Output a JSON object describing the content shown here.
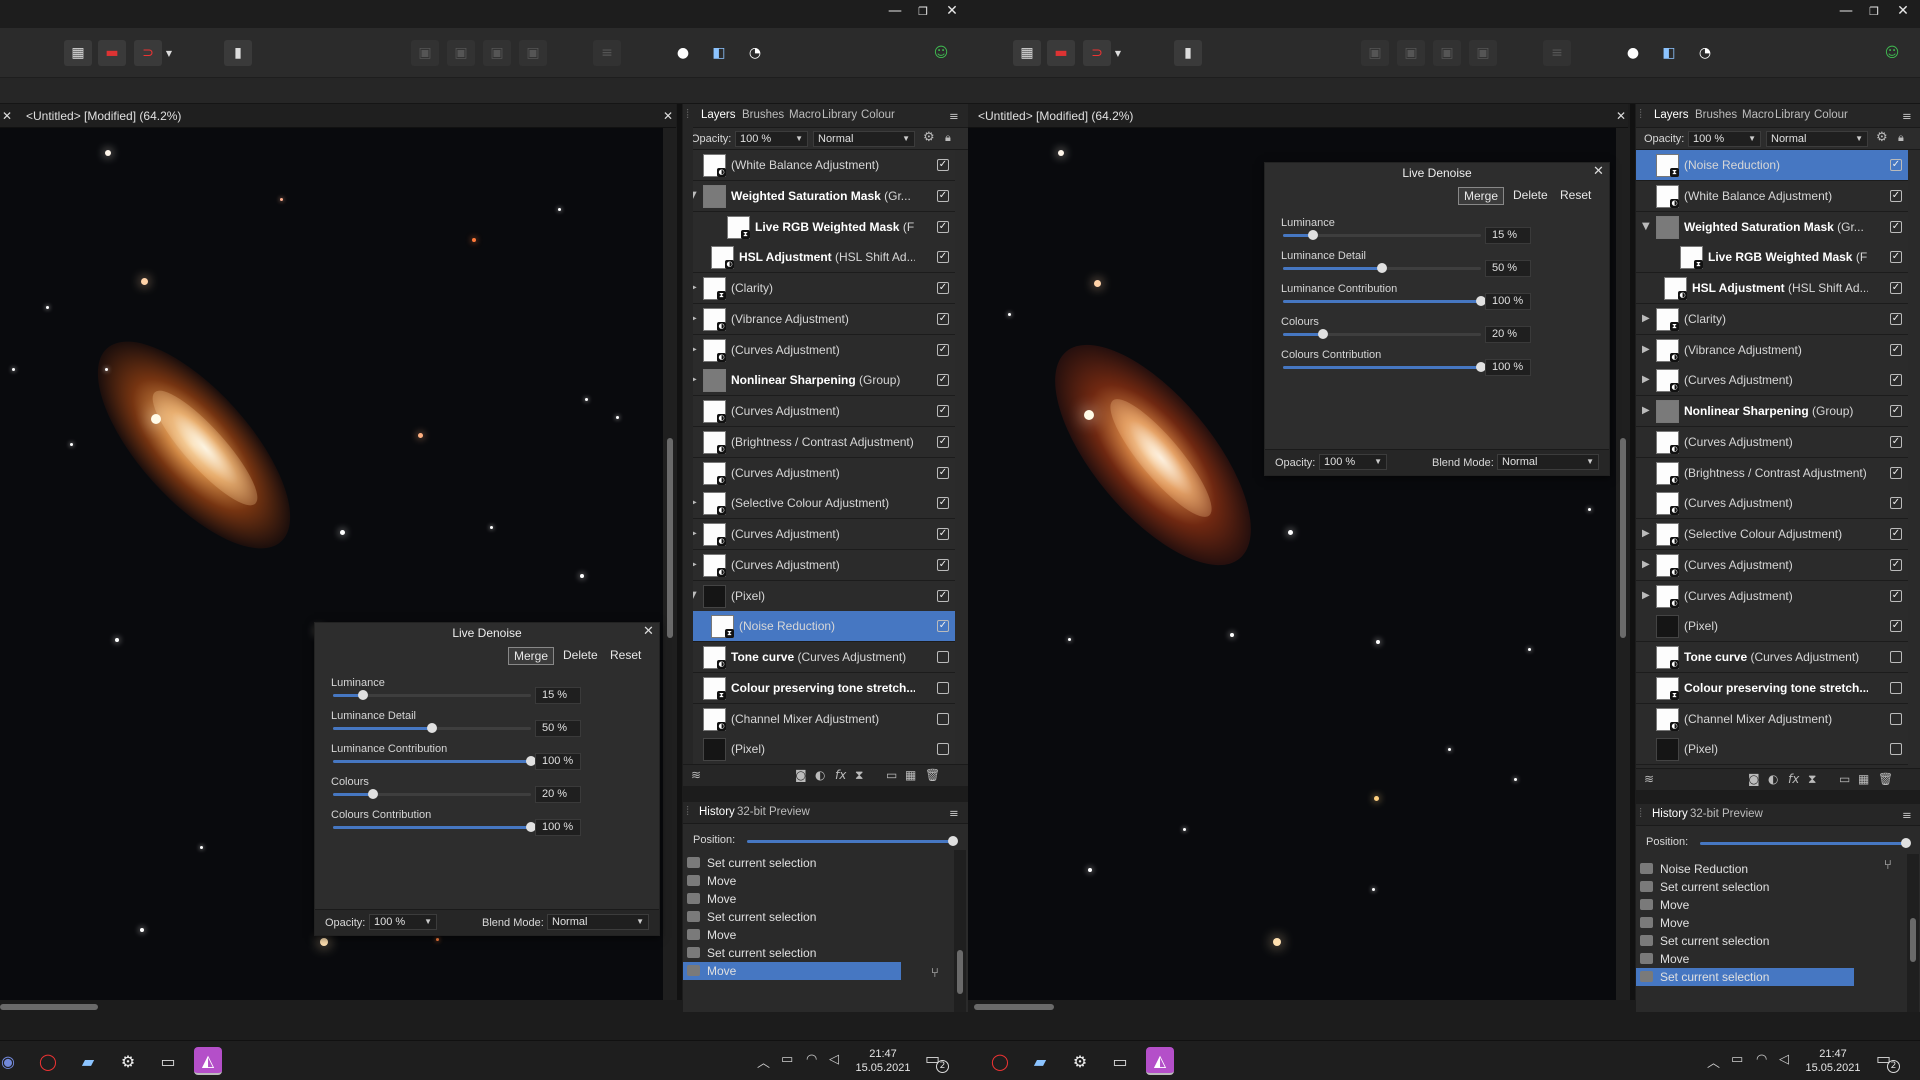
{
  "window": {
    "minimize_glyph": "—",
    "maximize_glyph": "❐",
    "close_glyph": "✕"
  },
  "toolbar_icons": [
    "grid-icon",
    "snapping-icon",
    "magnet-icon",
    "dropdown-icon",
    "assistant-icon",
    "align-icon-1",
    "align-icon-2",
    "align-icon-3",
    "align-icon-4",
    "distribute-icon",
    "quick-mask-icon",
    "selection-mode-icon",
    "refine-icon",
    "persona-user-icon"
  ],
  "document": {
    "tab_title": "<Untitled> [Modified] (64.2%)",
    "close_glyph": "✕"
  },
  "panels": {
    "tabs": [
      "Layers",
      "Brushes",
      "Macro",
      "Library",
      "Colour"
    ],
    "opacity_label": "Opacity:",
    "opacity_value": "100 %",
    "blend_value": "Normal"
  },
  "layers_left": [
    {
      "name": "(White Balance Adjustment)",
      "bold": "",
      "indent": 0,
      "expander": "",
      "checked": true,
      "thumb": "white",
      "badge": "◐"
    },
    {
      "name": " (Gr...",
      "bold": "Weighted Saturation Mask",
      "indent": 0,
      "expander": "▼",
      "checked": true,
      "thumb": "folder",
      "badge": ""
    },
    {
      "name": " (F",
      "bold": "Live RGB Weighted Mask",
      "indent": 2,
      "expander": "",
      "checked": true,
      "thumb": "white",
      "badge": "⧗"
    },
    {
      "name": " (HSL Shift Ad...",
      "bold": "HSL Adjustment",
      "indent": 1,
      "expander": "",
      "checked": true,
      "thumb": "white",
      "badge": "◐"
    },
    {
      "name": "(Clarity)",
      "bold": "",
      "indent": 0,
      "expander": "▶",
      "checked": true,
      "thumb": "white",
      "badge": "⧗"
    },
    {
      "name": "(Vibrance Adjustment)",
      "bold": "",
      "indent": 0,
      "expander": "▶",
      "checked": true,
      "thumb": "white",
      "badge": "◐"
    },
    {
      "name": "(Curves Adjustment)",
      "bold": "",
      "indent": 0,
      "expander": "▶",
      "checked": true,
      "thumb": "white",
      "badge": "◐"
    },
    {
      "name": " (Group)",
      "bold": "Nonlinear Sharpening",
      "indent": 0,
      "expander": "▶",
      "checked": true,
      "thumb": "folder",
      "badge": ""
    },
    {
      "name": "(Curves Adjustment)",
      "bold": "",
      "indent": 0,
      "expander": "",
      "checked": true,
      "thumb": "white",
      "badge": "◐"
    },
    {
      "name": "(Brightness / Contrast Adjustment)",
      "bold": "",
      "indent": 0,
      "expander": "",
      "checked": true,
      "thumb": "white",
      "badge": "◐"
    },
    {
      "name": "(Curves Adjustment)",
      "bold": "",
      "indent": 0,
      "expander": "",
      "checked": true,
      "thumb": "white",
      "badge": "◐"
    },
    {
      "name": "(Selective Colour Adjustment)",
      "bold": "",
      "indent": 0,
      "expander": "▶",
      "checked": true,
      "thumb": "white",
      "badge": "◐"
    },
    {
      "name": "(Curves Adjustment)",
      "bold": "",
      "indent": 0,
      "expander": "▶",
      "checked": true,
      "thumb": "white",
      "badge": "◐"
    },
    {
      "name": "(Curves Adjustment)",
      "bold": "",
      "indent": 0,
      "expander": "▶",
      "checked": true,
      "thumb": "white",
      "badge": "◐"
    },
    {
      "name": "(Pixel)",
      "bold": "",
      "indent": 0,
      "expander": "▼",
      "checked": true,
      "thumb": "dark",
      "badge": ""
    },
    {
      "name": "(Noise Reduction)",
      "bold": "",
      "indent": 1,
      "expander": "",
      "checked": true,
      "thumb": "white",
      "badge": "⧗",
      "selected": true
    },
    {
      "name": " (Curves Adjustment)",
      "bold": "Tone curve",
      "indent": 0,
      "expander": "",
      "checked": false,
      "thumb": "white",
      "badge": "◐"
    },
    {
      "name": "",
      "bold": "Colour preserving tone stretch...",
      "indent": 0,
      "expander": "",
      "checked": false,
      "thumb": "white",
      "badge": "⧗"
    },
    {
      "name": "(Channel Mixer Adjustment)",
      "bold": "",
      "indent": 0,
      "expander": "",
      "checked": false,
      "thumb": "white",
      "badge": "◐"
    },
    {
      "name": "(Pixel)",
      "bold": "",
      "indent": 0,
      "expander": "",
      "checked": false,
      "thumb": "dark",
      "badge": ""
    }
  ],
  "layers_right": [
    {
      "name": "(Noise Reduction)",
      "bold": "",
      "indent": 0,
      "expander": "",
      "checked": true,
      "thumb": "white",
      "badge": "⧗",
      "selected": true
    },
    {
      "name": "(White Balance Adjustment)",
      "bold": "",
      "indent": 0,
      "expander": "",
      "checked": true,
      "thumb": "white",
      "badge": "◐"
    },
    {
      "name": " (Gr...",
      "bold": "Weighted Saturation Mask",
      "indent": 0,
      "expander": "▼",
      "checked": true,
      "thumb": "folder",
      "badge": ""
    },
    {
      "name": " (F",
      "bold": "Live RGB Weighted Mask",
      "indent": 2,
      "expander": "",
      "checked": true,
      "thumb": "white",
      "badge": "⧗"
    },
    {
      "name": " (HSL Shift Ad...",
      "bold": "HSL Adjustment",
      "indent": 1,
      "expander": "",
      "checked": true,
      "thumb": "white",
      "badge": "◐"
    },
    {
      "name": "(Clarity)",
      "bold": "",
      "indent": 0,
      "expander": "▶",
      "checked": true,
      "thumb": "white",
      "badge": "⧗"
    },
    {
      "name": "(Vibrance Adjustment)",
      "bold": "",
      "indent": 0,
      "expander": "▶",
      "checked": true,
      "thumb": "white",
      "badge": "◐"
    },
    {
      "name": "(Curves Adjustment)",
      "bold": "",
      "indent": 0,
      "expander": "▶",
      "checked": true,
      "thumb": "white",
      "badge": "◐"
    },
    {
      "name": " (Group)",
      "bold": "Nonlinear Sharpening",
      "indent": 0,
      "expander": "▶",
      "checked": true,
      "thumb": "folder",
      "badge": ""
    },
    {
      "name": "(Curves Adjustment)",
      "bold": "",
      "indent": 0,
      "expander": "",
      "checked": true,
      "thumb": "white",
      "badge": "◐"
    },
    {
      "name": "(Brightness / Contrast Adjustment)",
      "bold": "",
      "indent": 0,
      "expander": "",
      "checked": true,
      "thumb": "white",
      "badge": "◐"
    },
    {
      "name": "(Curves Adjustment)",
      "bold": "",
      "indent": 0,
      "expander": "",
      "checked": true,
      "thumb": "white",
      "badge": "◐"
    },
    {
      "name": "(Selective Colour Adjustment)",
      "bold": "",
      "indent": 0,
      "expander": "▶",
      "checked": true,
      "thumb": "white",
      "badge": "◐"
    },
    {
      "name": "(Curves Adjustment)",
      "bold": "",
      "indent": 0,
      "expander": "▶",
      "checked": true,
      "thumb": "white",
      "badge": "◐"
    },
    {
      "name": "(Curves Adjustment)",
      "bold": "",
      "indent": 0,
      "expander": "▶",
      "checked": true,
      "thumb": "white",
      "badge": "◐"
    },
    {
      "name": "(Pixel)",
      "bold": "",
      "indent": 0,
      "expander": "",
      "checked": true,
      "thumb": "dark",
      "badge": ""
    },
    {
      "name": " (Curves Adjustment)",
      "bold": "Tone curve",
      "indent": 0,
      "expander": "",
      "checked": false,
      "thumb": "white",
      "badge": "◐"
    },
    {
      "name": "",
      "bold": "Colour preserving tone stretch...",
      "indent": 0,
      "expander": "",
      "checked": false,
      "thumb": "white",
      "badge": "⧗"
    },
    {
      "name": "(Channel Mixer Adjustment)",
      "bold": "",
      "indent": 0,
      "expander": "",
      "checked": false,
      "thumb": "white",
      "badge": "◐"
    },
    {
      "name": "(Pixel)",
      "bold": "",
      "indent": 0,
      "expander": "",
      "checked": false,
      "thumb": "dark",
      "badge": ""
    }
  ],
  "history": {
    "tabs": [
      "History",
      "32-bit Preview"
    ],
    "position_label": "Position:",
    "position_fraction": 1.0,
    "left_items": [
      {
        "label": "Set current selection",
        "selected": false
      },
      {
        "label": "Move",
        "selected": false
      },
      {
        "label": "Move",
        "selected": false
      },
      {
        "label": "Set current selection",
        "selected": false
      },
      {
        "label": "Move",
        "selected": false
      },
      {
        "label": "Set current selection",
        "selected": false
      },
      {
        "label": "Move",
        "selected": true
      }
    ],
    "right_items": [
      {
        "label": "Noise Reduction",
        "selected": false
      },
      {
        "label": "Set current selection",
        "selected": false
      },
      {
        "label": "Move",
        "selected": false
      },
      {
        "label": "Move",
        "selected": false
      },
      {
        "label": "Set current selection",
        "selected": false
      },
      {
        "label": "Move",
        "selected": false
      },
      {
        "label": "Set current selection",
        "selected": true
      }
    ]
  },
  "denoise": {
    "title": "Live Denoise",
    "merge": "Merge",
    "delete": "Delete",
    "reset": "Reset",
    "close_glyph": "✕",
    "params": [
      {
        "label": "Luminance",
        "value": "15 %",
        "fraction": 0.15
      },
      {
        "label": "Luminance Detail",
        "value": "50 %",
        "fraction": 0.5
      },
      {
        "label": "Luminance Contribution",
        "value": "100 %",
        "fraction": 1.0
      },
      {
        "label": "Colours",
        "value": "20 %",
        "fraction": 0.2
      },
      {
        "label": "Colours Contribution",
        "value": "100 %",
        "fraction": 1.0
      }
    ],
    "opacity_label": "Opacity:",
    "opacity_value": "100 %",
    "blend_label": "Blend Mode:",
    "blend_value": "Normal"
  },
  "taskbar": {
    "time": "21:47",
    "date": "15.05.2021",
    "notifications": "2",
    "left_apps": [
      "discord-icon",
      "opera-icon",
      "notepad-icon",
      "settings-icon",
      "photos-icon",
      "affinity-photo-icon"
    ],
    "right_apps": [
      "opera-icon",
      "notepad-icon",
      "settings-icon",
      "photos-icon",
      "affinity-photo-icon"
    ]
  },
  "colors": {
    "accent": "#4677c2",
    "panel_bg": "#2a2a2a",
    "canvas_bg": "#090a0d",
    "persona_green": "#3fb950",
    "affinity_purple": "#b44fc9"
  }
}
